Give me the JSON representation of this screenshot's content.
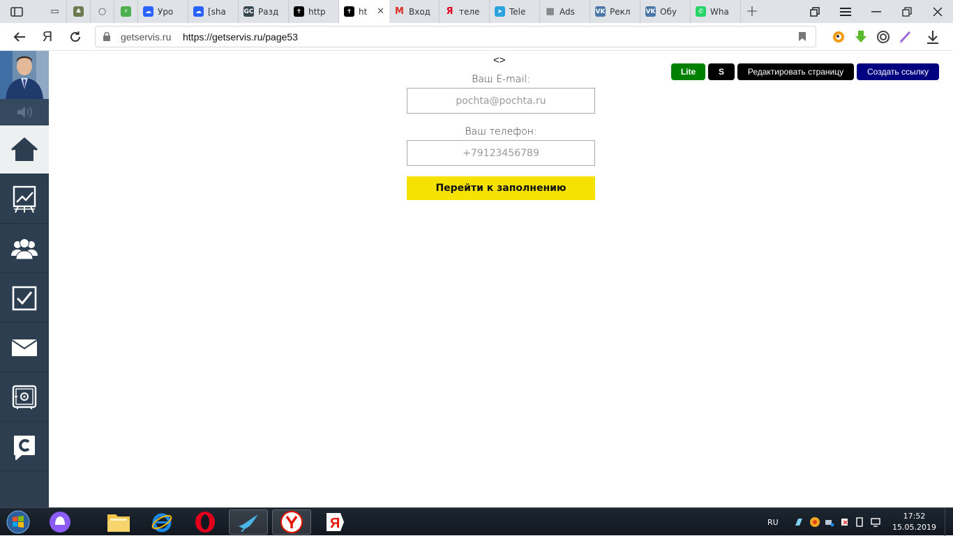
{
  "browser": {
    "tabs": [
      {
        "label": "",
        "favicon": "tab-strip-icon",
        "color": "#333"
      },
      {
        "label": "",
        "favicon": "tree-icon",
        "color": "#6b7b4f"
      },
      {
        "label": "",
        "favicon": "circle-icon",
        "color": "#555"
      },
      {
        "label": "",
        "favicon": "leaf-icon",
        "color": "#4caf50"
      },
      {
        "label": "Уро",
        "favicon": "cloud-icon",
        "color": "#2962ff"
      },
      {
        "label": "[sha",
        "favicon": "cloud-icon",
        "color": "#2962ff"
      },
      {
        "label": "Разд",
        "favicon": "gc-icon",
        "color": "#37474f"
      },
      {
        "label": "http",
        "favicon": "tilda-icon",
        "color": "#000"
      },
      {
        "label": "ht",
        "favicon": "tilda-icon",
        "color": "#000",
        "active": true
      },
      {
        "label": "Вход",
        "favicon": "gmail-icon",
        "color": "#d93025"
      },
      {
        "label": "теле",
        "favicon": "yandex-icon",
        "color": "#e0001b"
      },
      {
        "label": "Tele",
        "favicon": "telegram-icon",
        "color": "#2aa3df"
      },
      {
        "label": "Ads",
        "favicon": "ads-icon",
        "color": "#555"
      },
      {
        "label": "Рекл",
        "favicon": "vk-icon",
        "color": "#4a76a8"
      },
      {
        "label": "Обу",
        "favicon": "vk-icon",
        "color": "#4a76a8"
      },
      {
        "label": "Wha",
        "favicon": "whatsapp-icon",
        "color": "#25d366"
      }
    ],
    "address": {
      "domain": "getservis.ru",
      "url": "https://getservis.ru/page53"
    }
  },
  "sidebar": {
    "items": [
      {
        "icon": "home-icon",
        "active": true
      },
      {
        "icon": "chart-board-icon"
      },
      {
        "icon": "users-icon"
      },
      {
        "icon": "checkbox-icon"
      },
      {
        "icon": "mail-icon"
      },
      {
        "icon": "safe-icon"
      },
      {
        "icon": "chat-c-icon"
      }
    ]
  },
  "page": {
    "code_mark": "<>",
    "email_label": "Ваш E-mail:",
    "email_placeholder": "pochta@pochta.ru",
    "phone_label": "Ваш телефон:",
    "phone_placeholder": "+79123456789",
    "submit_label": "Перейти к заполнению",
    "top_buttons": {
      "lite": "Lite",
      "s": "S",
      "edit": "Редактировать страницу",
      "create_link": "Создать ссылку"
    },
    "colors": {
      "lite": "#008000",
      "s": "#000000",
      "edit": "#000000",
      "create_link": "#000080",
      "submit": "#f5e200"
    }
  },
  "taskbar": {
    "language": "RU",
    "time": "17:52",
    "date": "15.05.2019"
  }
}
